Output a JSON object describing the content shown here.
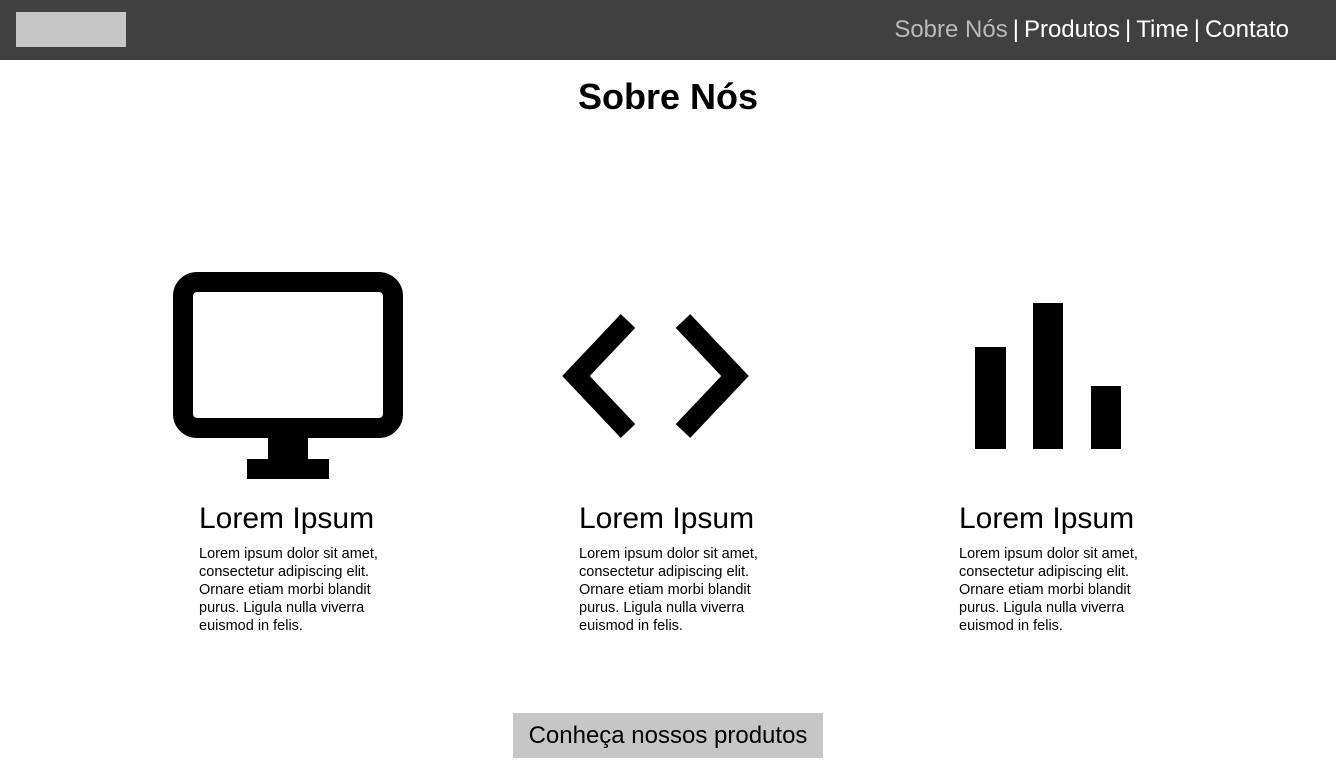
{
  "header": {
    "nav": [
      {
        "label": "Sobre Nós",
        "active": true
      },
      {
        "label": "Produtos",
        "active": false
      },
      {
        "label": "Time",
        "active": false
      },
      {
        "label": "Contato",
        "active": false
      }
    ],
    "separator": "|"
  },
  "main": {
    "title": "Sobre Nós",
    "features": [
      {
        "icon": "monitor-icon",
        "heading": "Lorem Ipsum",
        "text": "Lorem ipsum dolor sit amet, consectetur adipiscing elit. Ornare etiam morbi blandit purus. Ligula nulla viverra euismod in felis."
      },
      {
        "icon": "code-icon",
        "heading": "Lorem Ipsum",
        "text": "Lorem ipsum dolor sit amet, consectetur adipiscing elit. Ornare etiam morbi blandit purus. Ligula nulla viverra euismod in felis."
      },
      {
        "icon": "bar-chart-icon",
        "heading": "Lorem Ipsum",
        "text": "Lorem ipsum dolor sit amet, consectetur adipiscing elit. Ornare etiam morbi blandit purus. Ligula nulla viverra euismod in felis."
      }
    ],
    "cta_label": "Conheça nossos produtos"
  },
  "colors": {
    "header_bg": "#404040",
    "placeholder_gray": "#c6c6c6",
    "nav_active": "#b9b9b9",
    "nav_text": "#ffffff"
  }
}
